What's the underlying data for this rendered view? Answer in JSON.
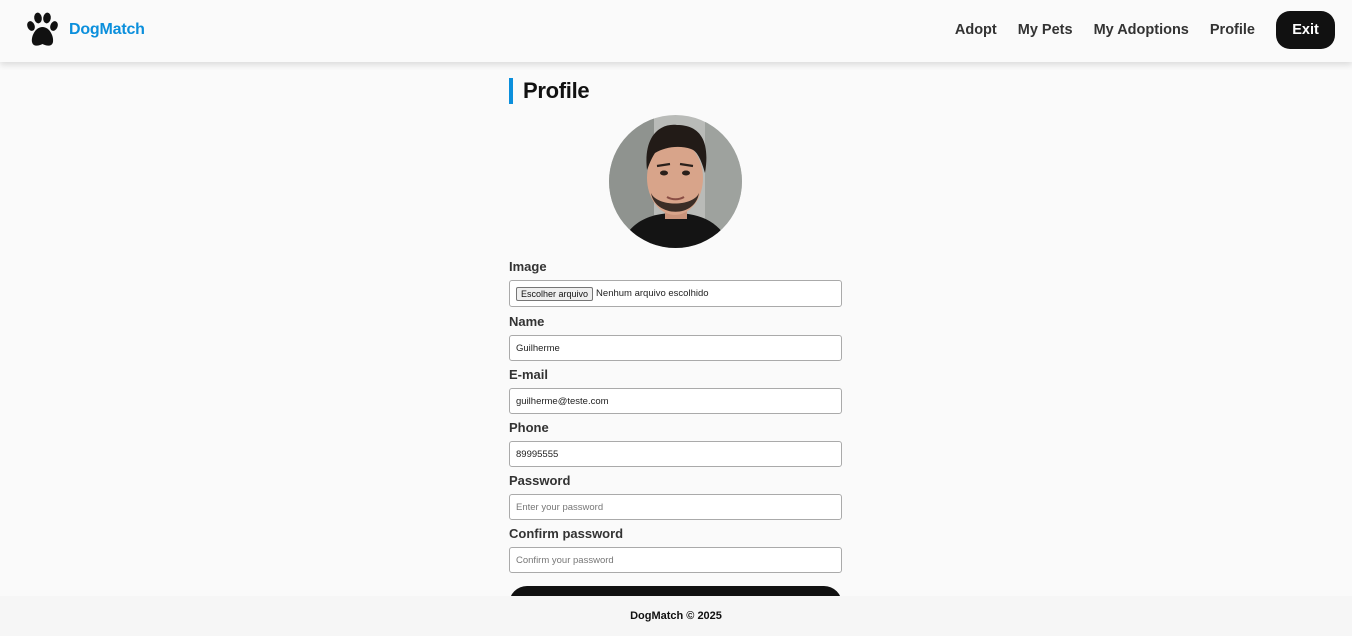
{
  "colors": {
    "accent": "#0b8fdc",
    "dark": "#111111",
    "background": "#fafafa"
  },
  "brand": {
    "logo_icon": "paw-icon",
    "name": "DogMatch"
  },
  "nav": {
    "links": [
      "Adopt",
      "My Pets",
      "My Adoptions",
      "Profile"
    ],
    "exit_label": "Exit"
  },
  "page": {
    "title": "Profile"
  },
  "form": {
    "image": {
      "label": "Image",
      "button": "Escolher arquivo",
      "status": "Nenhum arquivo escolhido"
    },
    "name": {
      "label": "Name",
      "value": "Guilherme"
    },
    "email": {
      "label": "E-mail",
      "value": "guilherme@teste.com"
    },
    "phone": {
      "label": "Phone",
      "value": "89995555"
    },
    "password": {
      "label": "Password",
      "placeholder": "Enter your password"
    },
    "confirm_password": {
      "label": "Confirm password",
      "placeholder": "Confirm your password"
    }
  },
  "footer": {
    "text": "DogMatch © 2025"
  }
}
